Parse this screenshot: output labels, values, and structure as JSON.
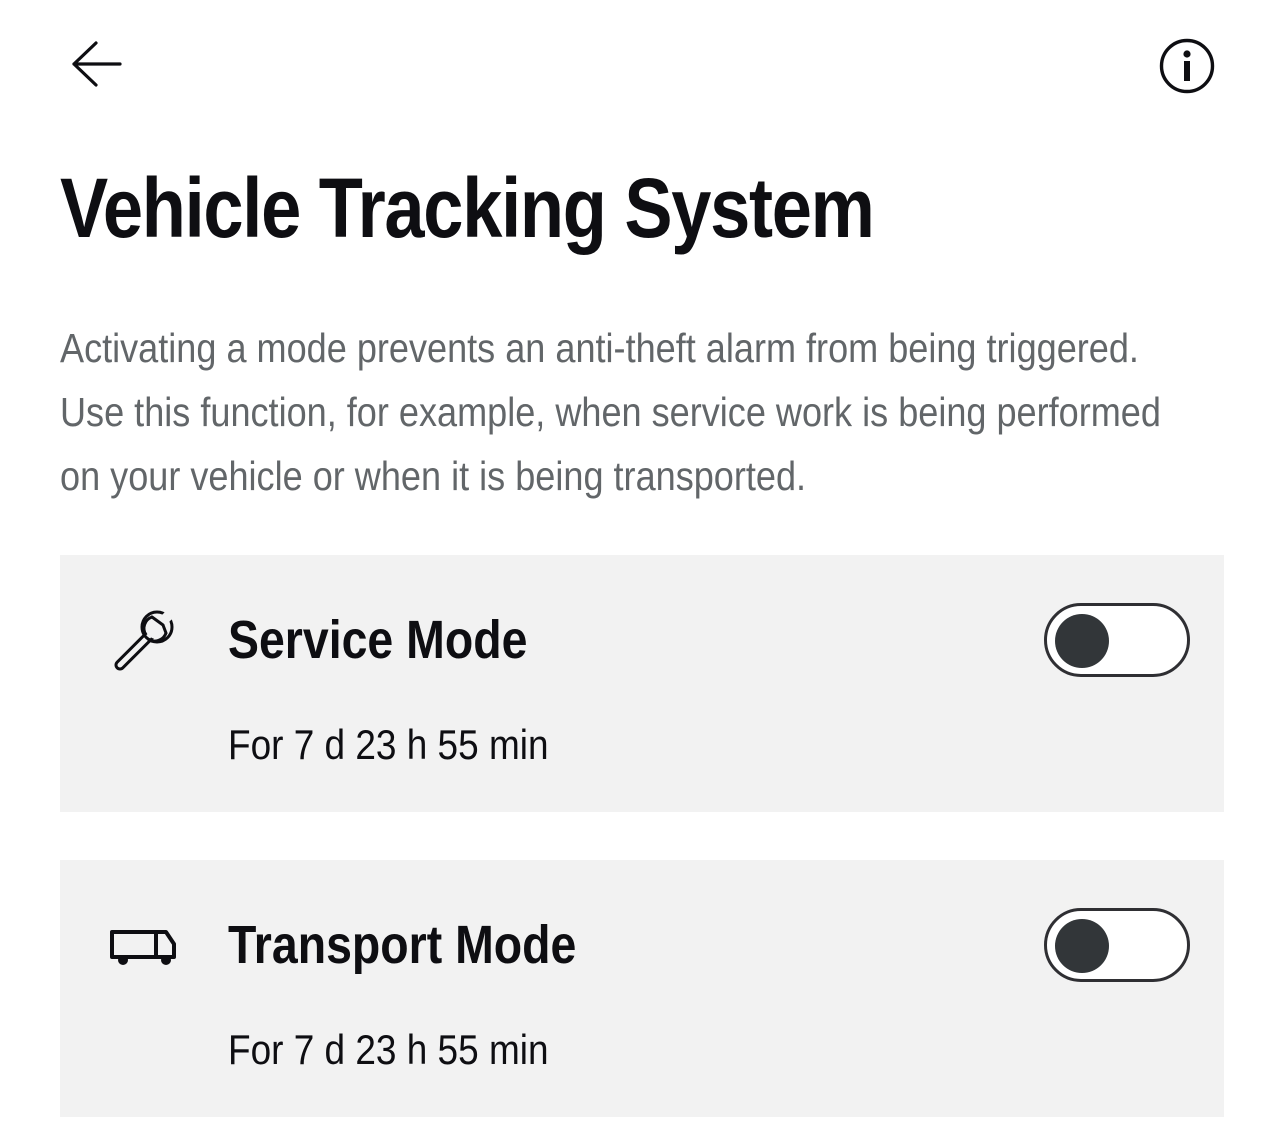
{
  "header": {
    "back_icon": "arrow-left-icon",
    "info_icon": "info-circle-icon"
  },
  "page": {
    "title": "Vehicle Tracking System",
    "description": "Activating a mode prevents an anti-theft alarm from being triggered. Use this function, for example, when service work is being performed on your vehicle or when it is being transported."
  },
  "modes": [
    {
      "icon": "wrench-icon",
      "title": "Service Mode",
      "duration": "For 7 d 23 h 55 min",
      "enabled": false
    },
    {
      "icon": "truck-icon",
      "title": "Transport Mode",
      "duration": "For 7 d 23 h 55 min",
      "enabled": false
    }
  ],
  "colors": {
    "text_primary": "#0e0e12",
    "text_secondary": "#626669",
    "card_background": "#f2f2f2",
    "toggle_knob": "#323639"
  }
}
